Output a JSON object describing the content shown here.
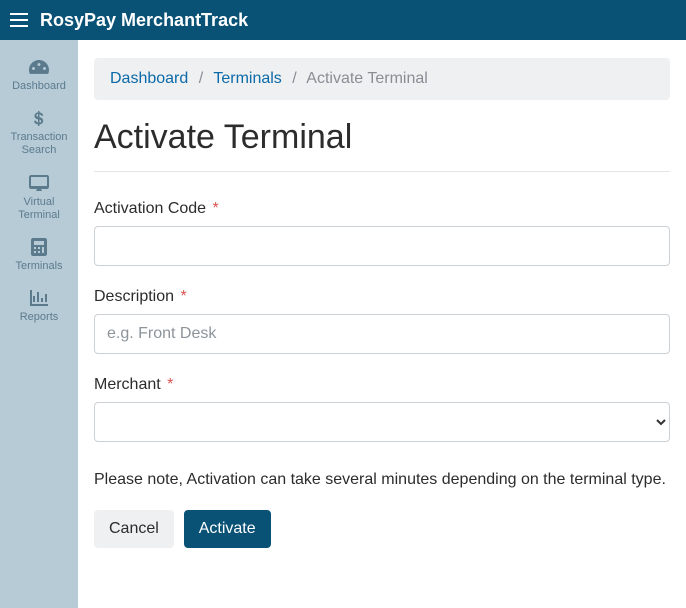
{
  "header": {
    "brand": "RosyPay MerchantTrack"
  },
  "sidebar": {
    "items": [
      {
        "label": "Dashboard"
      },
      {
        "label": "Transaction Search"
      },
      {
        "label": "Virtual Terminal"
      },
      {
        "label": "Terminals"
      },
      {
        "label": "Reports"
      }
    ]
  },
  "breadcrumb": {
    "items": [
      {
        "label": "Dashboard"
      },
      {
        "label": "Terminals"
      }
    ],
    "active": "Activate Terminal",
    "separator": "/"
  },
  "page": {
    "title": "Activate Terminal"
  },
  "form": {
    "activation_code": {
      "label": "Activation Code",
      "value": ""
    },
    "description": {
      "label": "Description",
      "placeholder": "e.g. Front Desk",
      "value": ""
    },
    "merchant": {
      "label": "Merchant",
      "selected": ""
    },
    "note": "Please note, Activation can take several minutes depending on the terminal type.",
    "required_marker": "*",
    "buttons": {
      "cancel": "Cancel",
      "activate": "Activate"
    }
  }
}
